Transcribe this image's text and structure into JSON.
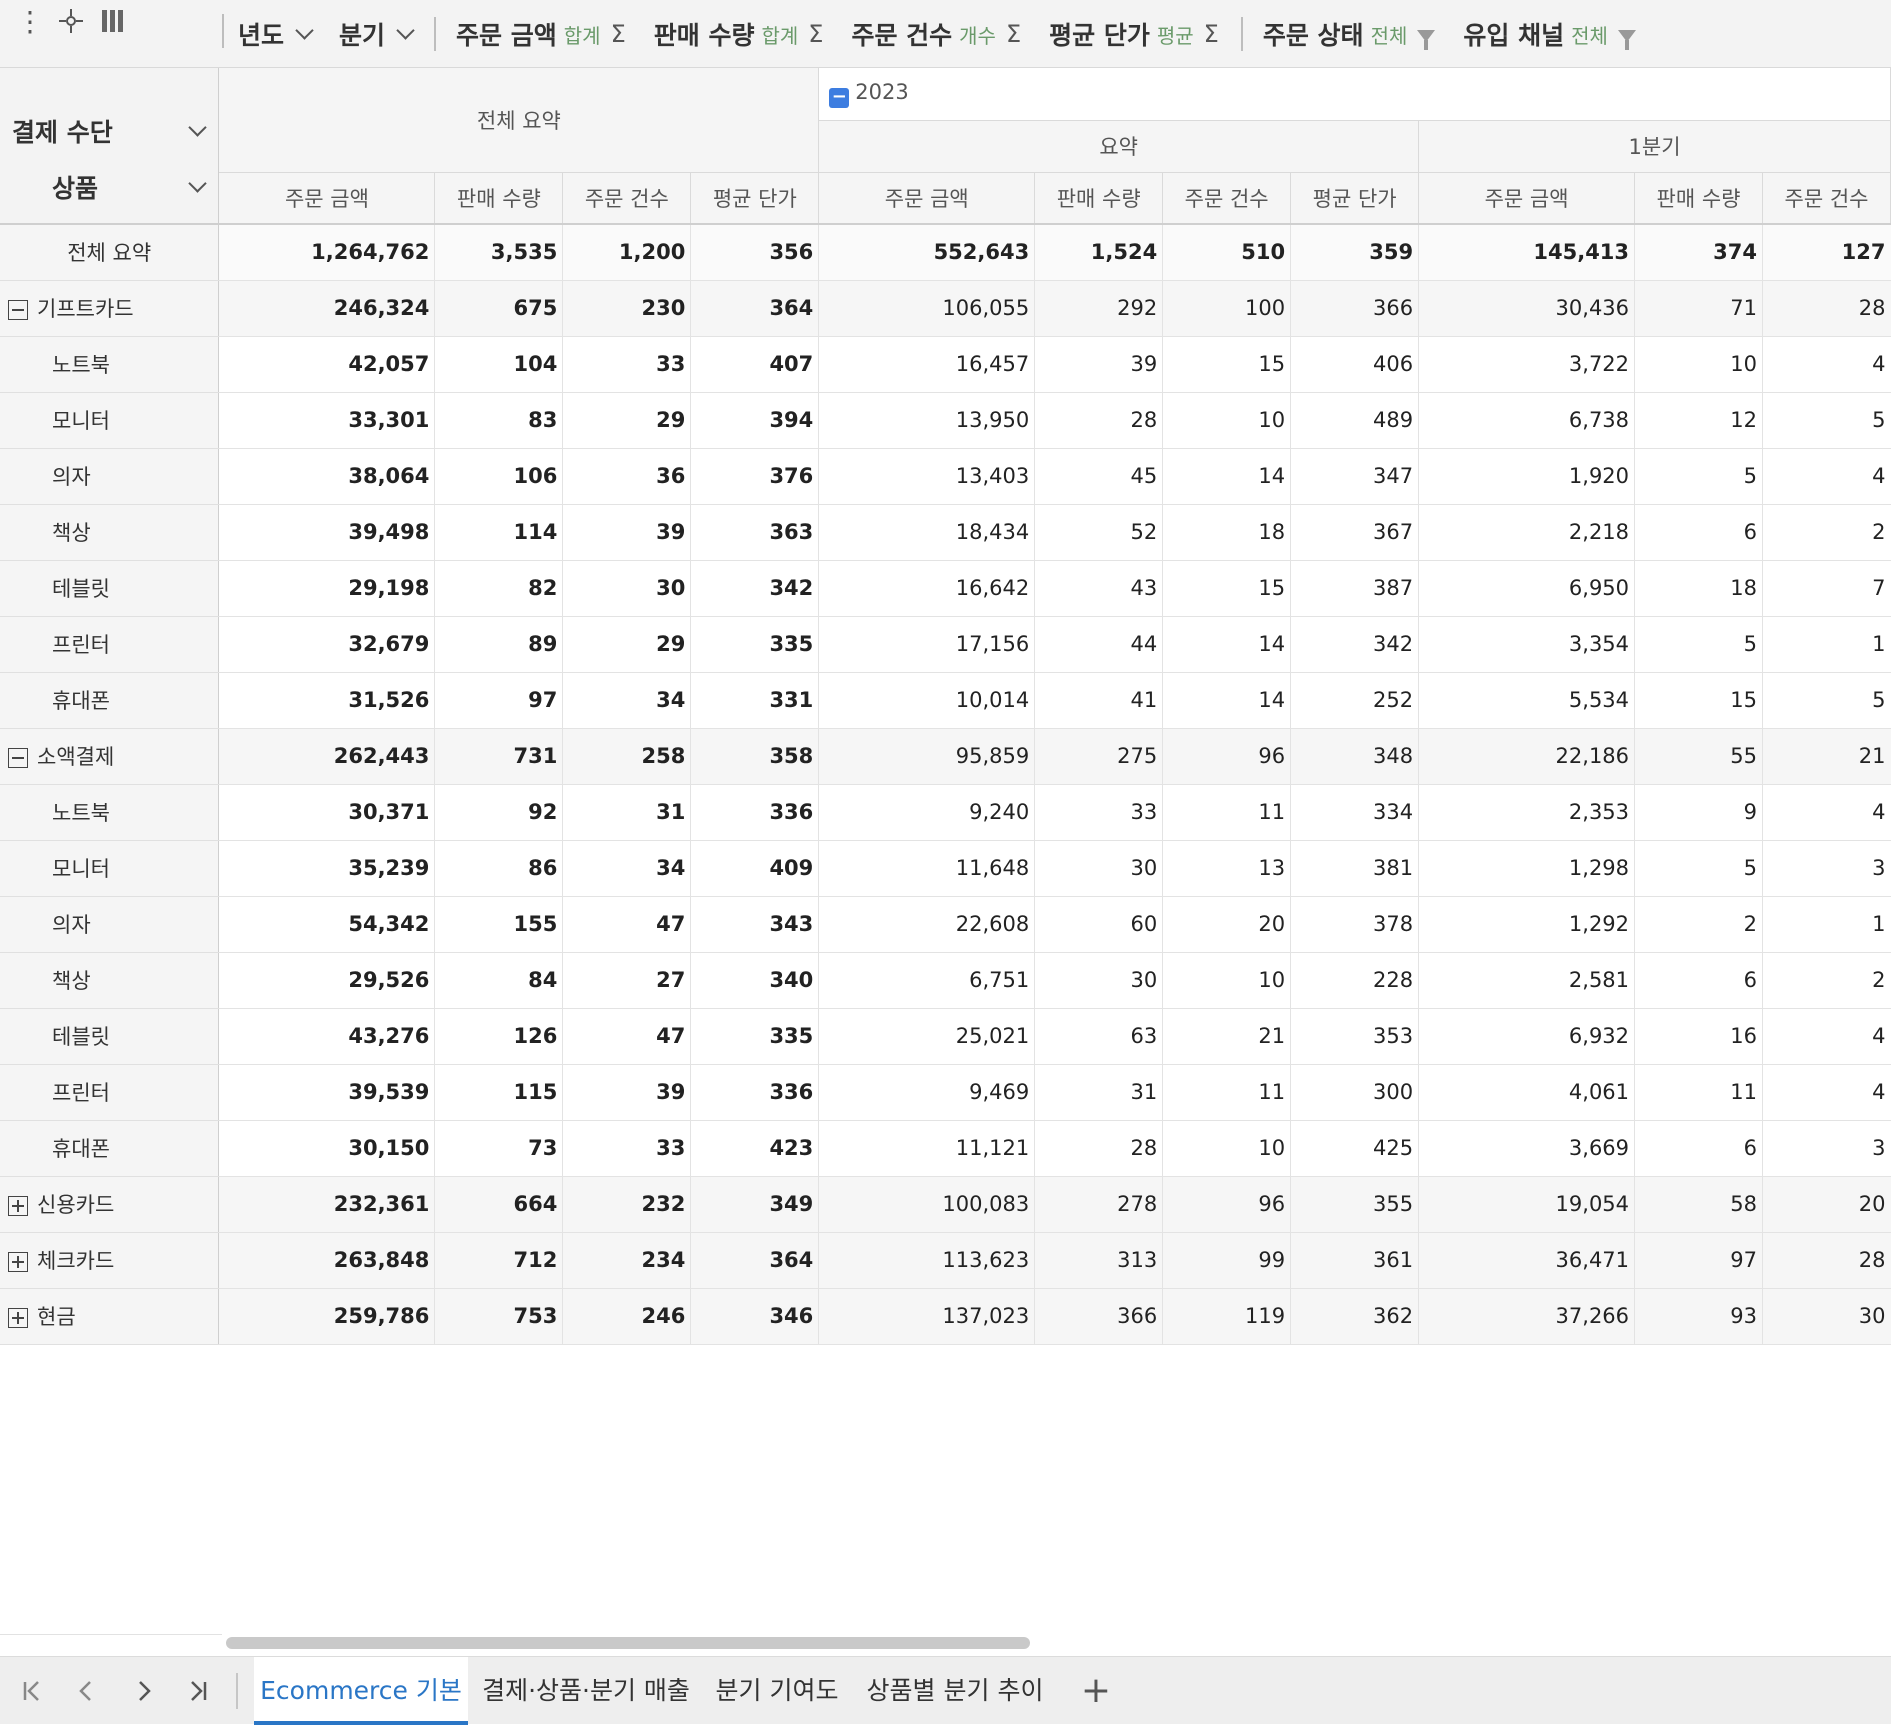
{
  "toolbar": {
    "icons": [
      "more-vertical-icon",
      "crosshair-icon",
      "columns-icon"
    ],
    "column_fields": [
      {
        "label": "년도",
        "kind": "dropdown"
      },
      {
        "label": "분기",
        "kind": "dropdown"
      }
    ],
    "value_fields": [
      {
        "label": "주문 금액",
        "agg": "합계"
      },
      {
        "label": "판매 수량",
        "agg": "합계"
      },
      {
        "label": "주문 건수",
        "agg": "개수"
      },
      {
        "label": "평균 단가",
        "agg": "평균"
      }
    ],
    "filter_fields": [
      {
        "label": "주문 상태",
        "value": "전체"
      },
      {
        "label": "유입 채널",
        "value": "전체"
      }
    ],
    "sigma": "Σ"
  },
  "row_fields": [
    "결제 수단",
    "상품"
  ],
  "column_headers": {
    "grand_total": "전체 요약",
    "year": "2023",
    "year_toggle": "−",
    "year_summary": "요약",
    "quarter": "1분기",
    "measures": [
      "주문 금액",
      "판매 수량",
      "주문 건수",
      "평균 단가"
    ]
  },
  "rows": [
    {
      "label": "전체 요약",
      "kind": "grand",
      "total": [
        "1,264,762",
        "3,535",
        "1,200",
        "356"
      ],
      "y2023": [
        "552,643",
        "1,524",
        "510",
        "359"
      ],
      "q1": [
        "145,413",
        "374",
        "127"
      ]
    },
    {
      "label": "기프트카드",
      "kind": "group",
      "toggle": "collapse",
      "total": [
        "246,324",
        "675",
        "230",
        "364"
      ],
      "y2023": [
        "106,055",
        "292",
        "100",
        "366"
      ],
      "q1": [
        "30,436",
        "71",
        "28"
      ]
    },
    {
      "label": "노트북",
      "kind": "sub",
      "total": [
        "42,057",
        "104",
        "33",
        "407"
      ],
      "y2023": [
        "16,457",
        "39",
        "15",
        "406"
      ],
      "q1": [
        "3,722",
        "10",
        "4"
      ]
    },
    {
      "label": "모니터",
      "kind": "sub",
      "total": [
        "33,301",
        "83",
        "29",
        "394"
      ],
      "y2023": [
        "13,950",
        "28",
        "10",
        "489"
      ],
      "q1": [
        "6,738",
        "12",
        "5"
      ]
    },
    {
      "label": "의자",
      "kind": "sub",
      "total": [
        "38,064",
        "106",
        "36",
        "376"
      ],
      "y2023": [
        "13,403",
        "45",
        "14",
        "347"
      ],
      "q1": [
        "1,920",
        "5",
        "4"
      ]
    },
    {
      "label": "책상",
      "kind": "sub",
      "total": [
        "39,498",
        "114",
        "39",
        "363"
      ],
      "y2023": [
        "18,434",
        "52",
        "18",
        "367"
      ],
      "q1": [
        "2,218",
        "6",
        "2"
      ]
    },
    {
      "label": "테블릿",
      "kind": "sub",
      "total": [
        "29,198",
        "82",
        "30",
        "342"
      ],
      "y2023": [
        "16,642",
        "43",
        "15",
        "387"
      ],
      "q1": [
        "6,950",
        "18",
        "7"
      ]
    },
    {
      "label": "프린터",
      "kind": "sub",
      "total": [
        "32,679",
        "89",
        "29",
        "335"
      ],
      "y2023": [
        "17,156",
        "44",
        "14",
        "342"
      ],
      "q1": [
        "3,354",
        "5",
        "1"
      ]
    },
    {
      "label": "휴대폰",
      "kind": "sub",
      "total": [
        "31,526",
        "97",
        "34",
        "331"
      ],
      "y2023": [
        "10,014",
        "41",
        "14",
        "252"
      ],
      "q1": [
        "5,534",
        "15",
        "5"
      ]
    },
    {
      "label": "소액결제",
      "kind": "group",
      "toggle": "collapse",
      "total": [
        "262,443",
        "731",
        "258",
        "358"
      ],
      "y2023": [
        "95,859",
        "275",
        "96",
        "348"
      ],
      "q1": [
        "22,186",
        "55",
        "21"
      ]
    },
    {
      "label": "노트북",
      "kind": "sub",
      "total": [
        "30,371",
        "92",
        "31",
        "336"
      ],
      "y2023": [
        "9,240",
        "33",
        "11",
        "334"
      ],
      "q1": [
        "2,353",
        "9",
        "4"
      ]
    },
    {
      "label": "모니터",
      "kind": "sub",
      "total": [
        "35,239",
        "86",
        "34",
        "409"
      ],
      "y2023": [
        "11,648",
        "30",
        "13",
        "381"
      ],
      "q1": [
        "1,298",
        "5",
        "3"
      ]
    },
    {
      "label": "의자",
      "kind": "sub",
      "total": [
        "54,342",
        "155",
        "47",
        "343"
      ],
      "y2023": [
        "22,608",
        "60",
        "20",
        "378"
      ],
      "q1": [
        "1,292",
        "2",
        "1"
      ]
    },
    {
      "label": "책상",
      "kind": "sub",
      "total": [
        "29,526",
        "84",
        "27",
        "340"
      ],
      "y2023": [
        "6,751",
        "30",
        "10",
        "228"
      ],
      "q1": [
        "2,581",
        "6",
        "2"
      ]
    },
    {
      "label": "테블릿",
      "kind": "sub",
      "total": [
        "43,276",
        "126",
        "47",
        "335"
      ],
      "y2023": [
        "25,021",
        "63",
        "21",
        "353"
      ],
      "q1": [
        "6,932",
        "16",
        "4"
      ]
    },
    {
      "label": "프린터",
      "kind": "sub",
      "total": [
        "39,539",
        "115",
        "39",
        "336"
      ],
      "y2023": [
        "9,469",
        "31",
        "11",
        "300"
      ],
      "q1": [
        "4,061",
        "11",
        "4"
      ]
    },
    {
      "label": "휴대폰",
      "kind": "sub",
      "total": [
        "30,150",
        "73",
        "33",
        "423"
      ],
      "y2023": [
        "11,121",
        "28",
        "10",
        "425"
      ],
      "q1": [
        "3,669",
        "6",
        "3"
      ]
    },
    {
      "label": "신용카드",
      "kind": "group",
      "toggle": "expand",
      "total": [
        "232,361",
        "664",
        "232",
        "349"
      ],
      "y2023": [
        "100,083",
        "278",
        "96",
        "355"
      ],
      "q1": [
        "19,054",
        "58",
        "20"
      ]
    },
    {
      "label": "체크카드",
      "kind": "group",
      "toggle": "expand",
      "total": [
        "263,848",
        "712",
        "234",
        "364"
      ],
      "y2023": [
        "113,623",
        "313",
        "99",
        "361"
      ],
      "q1": [
        "36,471",
        "97",
        "28"
      ]
    },
    {
      "label": "현금",
      "kind": "group",
      "toggle": "expand",
      "total": [
        "259,786",
        "753",
        "246",
        "346"
      ],
      "y2023": [
        "137,023",
        "366",
        "119",
        "362"
      ],
      "q1": [
        "37,266",
        "93",
        "30"
      ]
    }
  ],
  "sheet_nav": {
    "icons": [
      "first-sheet-icon",
      "prev-sheet-icon",
      "next-sheet-icon",
      "last-sheet-icon"
    ]
  },
  "sheets": [
    {
      "label": "Ecommerce 기본",
      "active": true
    },
    {
      "label": "결제·상품·분기 매출",
      "active": false
    },
    {
      "label": "분기 기여도",
      "active": false
    },
    {
      "label": "상품별 분기 추이",
      "active": false
    }
  ],
  "add_sheet_icon": "+",
  "colors": {
    "accent": "#2a76c6",
    "aggregate_label": "#6a9a6a",
    "year_toggle": "#3d7de0"
  }
}
